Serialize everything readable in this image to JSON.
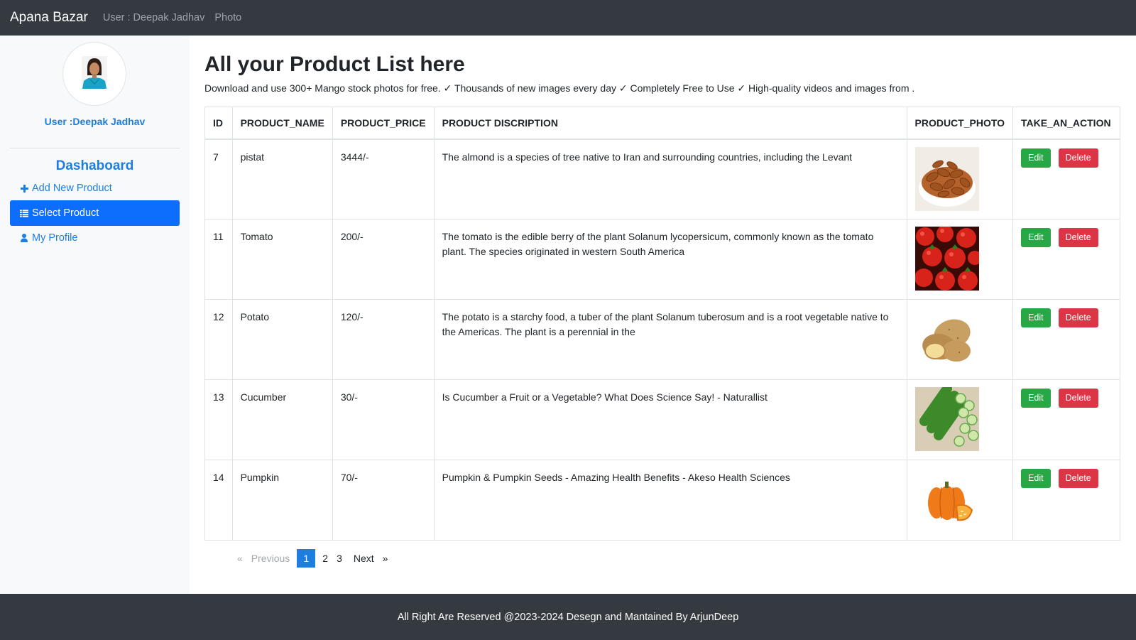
{
  "navbar": {
    "brand": "Apana Bazar",
    "links": [
      "User : Deepak Jadhav",
      "Photo"
    ]
  },
  "sidebar": {
    "user_label": "User :Deepak Jadhav",
    "title": "Dashaboard",
    "items": [
      {
        "label": "Add New Product",
        "icon": "plus-icon",
        "active": false
      },
      {
        "label": "Select Product",
        "icon": "list-icon",
        "active": true
      },
      {
        "label": "My Profile",
        "icon": "user-icon",
        "active": false
      }
    ]
  },
  "main": {
    "title": "All your Product List here",
    "subtitle": "Download and use 300+ Mango stock photos for free. ✓ Thousands of new images every day ✓ Completely Free to Use ✓ High-quality videos and images from ."
  },
  "table": {
    "headers": [
      "ID",
      "PRODUCT_NAME",
      "PRODUCT_PRICE",
      "PRODUCT DISCRIPTION",
      "PRODUCT_PHOTO",
      "TAKE_AN_ACTION"
    ],
    "rows": [
      {
        "id": "7",
        "name": "pistat",
        "price": "3444/-",
        "description": "The almond is a species of tree native to Iran and surrounding countries, including the Levant",
        "photo": "almond-photo"
      },
      {
        "id": "11",
        "name": "Tomato",
        "price": "200/-",
        "description": "The tomato is the edible berry of the plant Solanum lycopersicum, commonly known as the tomato plant. The species originated in western South America",
        "photo": "tomato-photo"
      },
      {
        "id": "12",
        "name": "Potato",
        "price": "120/-",
        "description": "The potato is a starchy food, a tuber of the plant Solanum tuberosum and is a root vegetable native to the Americas. The plant is a perennial in the",
        "photo": "potato-photo"
      },
      {
        "id": "13",
        "name": "Cucumber",
        "price": "30/-",
        "description": "Is Cucumber a Fruit or a Vegetable? What Does Science Say! - Naturallist",
        "photo": "cucumber-photo"
      },
      {
        "id": "14",
        "name": "Pumpkin",
        "price": "70/-",
        "description": "Pumpkin & Pumpkin Seeds - Amazing Health Benefits - Akeso Health Sciences",
        "photo": "pumpkin-photo"
      }
    ],
    "edit_label": "Edit",
    "delete_label": "Delete"
  },
  "pagination": {
    "prev_arrow": "«",
    "previous": "Previous",
    "pages": [
      "1",
      "2",
      "3"
    ],
    "current": "1",
    "next": "Next",
    "next_arrow": "»"
  },
  "footer": {
    "text": "All Right Are Reserved @2023-2024 Desegn and Mantained By ArjunDeep"
  },
  "colors": {
    "navbar": "#343a40",
    "accent": "#1e7ee0",
    "active": "#0d6efd",
    "edit": "#28a745",
    "delete": "#dc3545"
  }
}
